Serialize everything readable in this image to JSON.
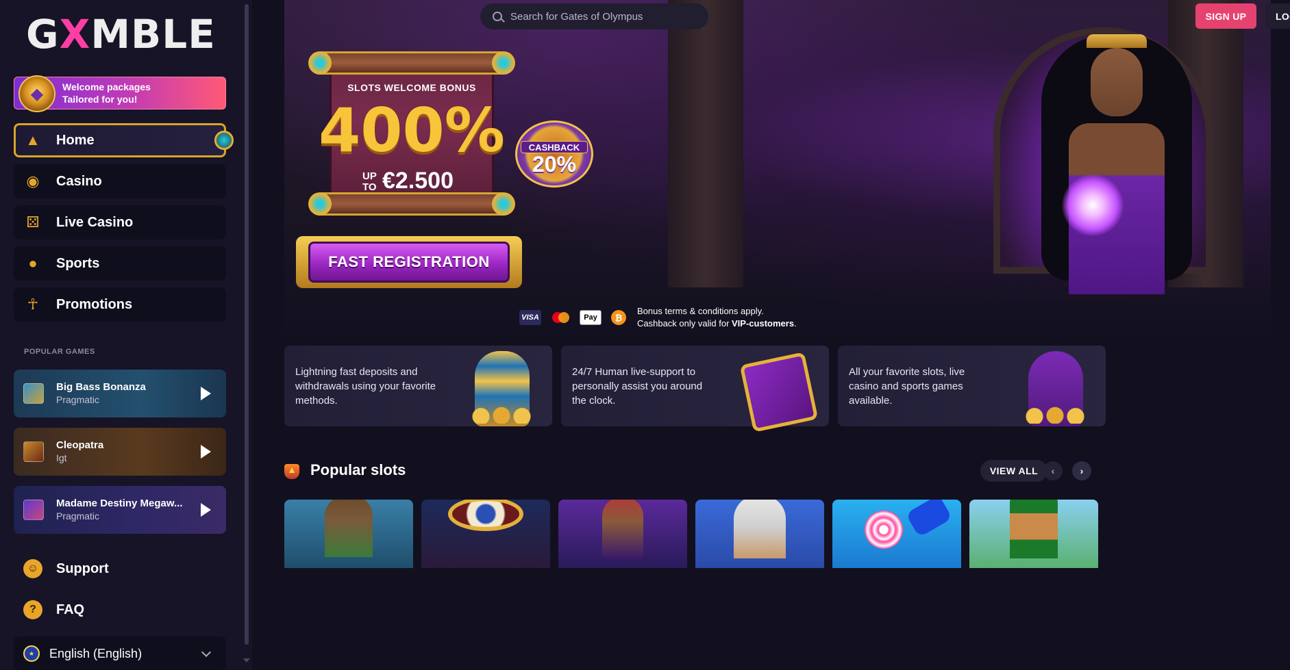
{
  "brand": {
    "logo_left": "G",
    "logo_x": "X",
    "logo_right": "MBLE"
  },
  "welcome": {
    "line1": "Welcome packages",
    "line2": "Tailored for you!"
  },
  "nav": [
    {
      "label": "Home",
      "icon": "pyramid-icon"
    },
    {
      "label": "Casino",
      "icon": "coin-icon"
    },
    {
      "label": "Live Casino",
      "icon": "dice-icon"
    },
    {
      "label": "Sports",
      "icon": "ball-icon"
    },
    {
      "label": "Promotions",
      "icon": "ankh-icon"
    }
  ],
  "popular_games_label": "POPULAR GAMES",
  "popular_games": [
    {
      "name": "Big Bass Bonanza",
      "provider": "Pragmatic"
    },
    {
      "name": "Cleopatra",
      "provider": "Igt"
    },
    {
      "name": "Madame Destiny Megaw...",
      "provider": "Pragmatic"
    }
  ],
  "bottom_nav": [
    {
      "label": "Support",
      "icon": "support-icon"
    },
    {
      "label": "FAQ",
      "icon": "question-icon"
    }
  ],
  "language": {
    "label": "English (English)"
  },
  "search": {
    "placeholder": "Search for Gates of Olympus"
  },
  "header": {
    "signup": "SIGN UP",
    "login": "LOG IN"
  },
  "hero": {
    "kicker": "SLOTS WELCOME BONUS",
    "percent": "400%",
    "up_to_1": "UP",
    "up_to_2": "TO",
    "amount": "€2.500",
    "cashback_label": "CASHBACK",
    "cashback_value": "20%",
    "cta": "FAST REGISTRATION"
  },
  "payments": {
    "visa": "VISA",
    "applepay": "Pay",
    "btc": "₿",
    "terms_line1": "Bonus terms & conditions apply.",
    "terms_line2a": "Cashback only valid for ",
    "terms_line2b": "VIP-customers",
    "terms_line2c": "."
  },
  "features": [
    "Lightning fast deposits and withdrawals using your favorite methods.",
    "24/7 Human live-support to personally assist you around the clock.",
    "All your favorite slots, live casino and sports games available."
  ],
  "popular_slots": {
    "title": "Popular slots",
    "view_all": "VIEW ALL",
    "prev": "‹",
    "next": "›"
  },
  "colors": {
    "accent_pink": "#e6426f",
    "gold": "#d7a629",
    "sidebar_bg": "#161426",
    "page_bg": "#12101f"
  }
}
